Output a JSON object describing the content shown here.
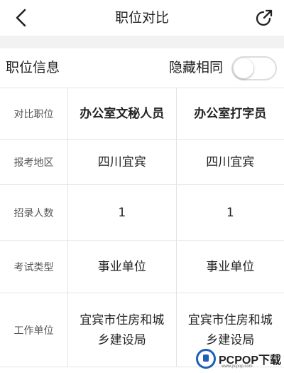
{
  "header": {
    "title": "职位对比",
    "back_icon": "chevron-left-icon",
    "share_icon": "share-icon"
  },
  "info_bar": {
    "title": "职位信息",
    "hide_same_label": "隐藏相同",
    "hide_same_toggle": "off"
  },
  "table": {
    "header_label": "对比职位",
    "positions": [
      "办公室文秘人员",
      "办公室打字员"
    ],
    "rows": [
      {
        "label": "报考地区",
        "values": [
          "四川宜宾",
          "四川宜宾"
        ]
      },
      {
        "label": "招录人数",
        "values": [
          "1",
          "1"
        ]
      },
      {
        "label": "考试类型",
        "values": [
          "事业单位",
          "事业单位"
        ]
      },
      {
        "label": "工作单位",
        "values": [
          "宜宾市住房和城乡建设局",
          "宜宾市住房和城乡建设局"
        ]
      }
    ]
  },
  "watermark": {
    "text": "PCPOP下载",
    "subtext": "www.pcpop.com"
  },
  "colors": {
    "background": "#ffffff",
    "band": "#f2f2f2",
    "grid_line": "#e4e4e4",
    "label_text": "#555555",
    "primary_text": "#222222",
    "watermark_blue": "#1f5fb8"
  }
}
